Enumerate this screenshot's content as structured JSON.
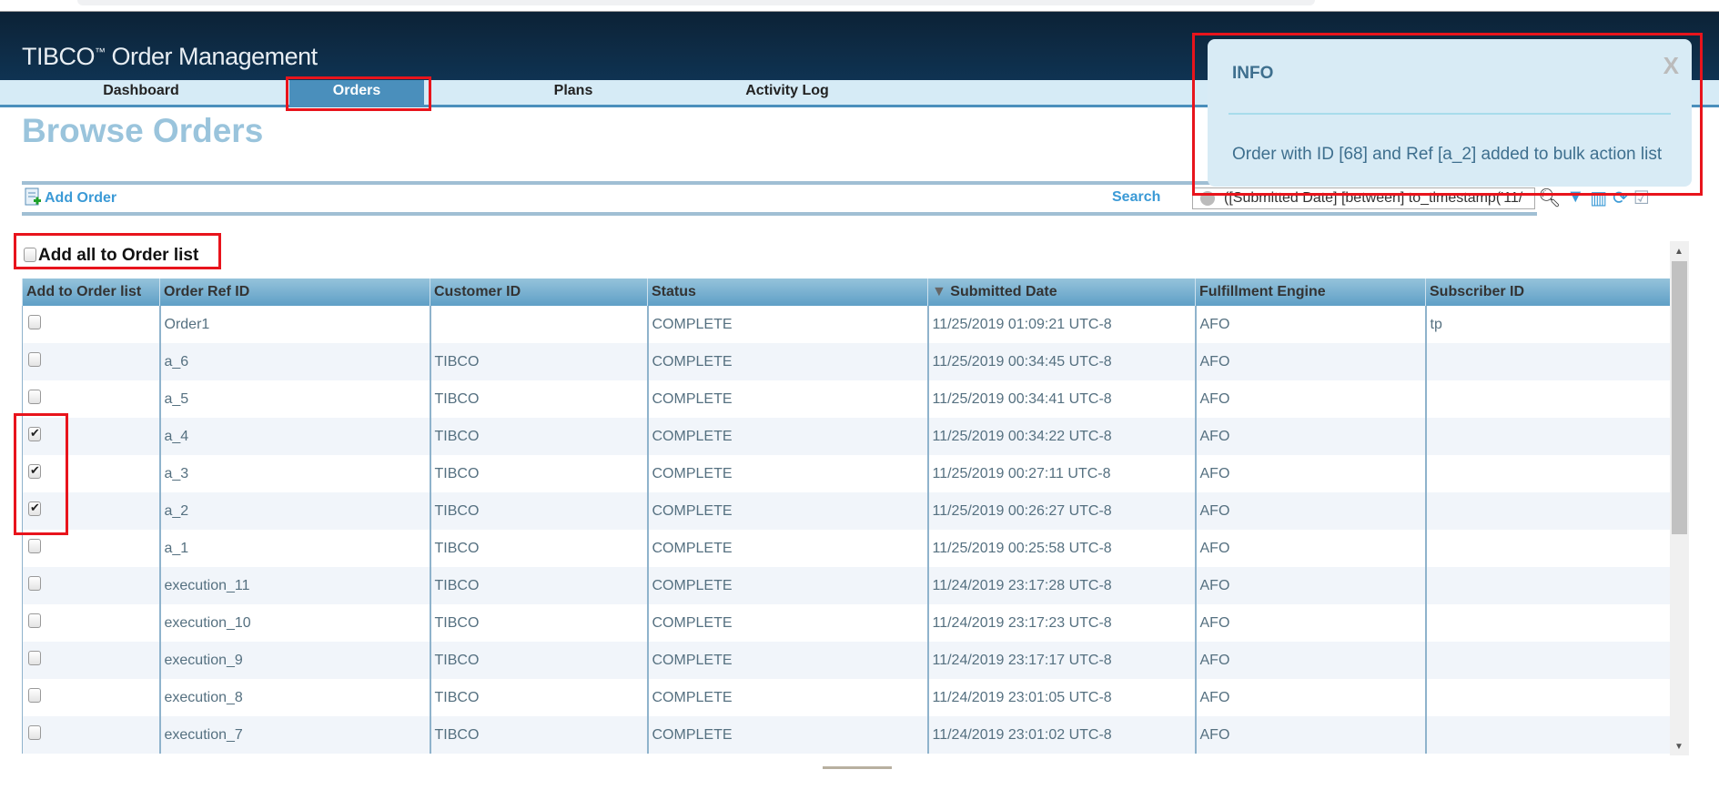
{
  "app": {
    "brand": "TIBCO",
    "tm": "™",
    "title": "Order Management"
  },
  "nav": {
    "tabs": [
      {
        "label": "Dashboard"
      },
      {
        "label": "Orders",
        "active": true
      },
      {
        "label": "Plans"
      },
      {
        "label": "Activity Log"
      }
    ]
  },
  "page": {
    "title": "Browse Orders"
  },
  "toolbar": {
    "add_order": "Add Order",
    "search_label": "Search",
    "search_value": "([Submitted Date] [between] to_timestamp('11/"
  },
  "bulk": {
    "add_all_label": "Add all to Order list",
    "checked": false
  },
  "table": {
    "columns": [
      "Add to Order list",
      "Order Ref ID",
      "Customer ID",
      "Status",
      "Submitted Date",
      "Fulfillment Engine",
      "Subscriber ID"
    ],
    "sort_column": "Submitted Date",
    "sort_direction": "descending",
    "rows": [
      {
        "checked": false,
        "ref": "Order1",
        "customer": "",
        "status": "COMPLETE",
        "date": "11/25/2019 01:09:21 UTC-8",
        "engine": "AFO",
        "subscriber": "tp"
      },
      {
        "checked": false,
        "ref": "a_6",
        "customer": "TIBCO",
        "status": "COMPLETE",
        "date": "11/25/2019 00:34:45 UTC-8",
        "engine": "AFO",
        "subscriber": ""
      },
      {
        "checked": false,
        "ref": "a_5",
        "customer": "TIBCO",
        "status": "COMPLETE",
        "date": "11/25/2019 00:34:41 UTC-8",
        "engine": "AFO",
        "subscriber": ""
      },
      {
        "checked": true,
        "ref": "a_4",
        "customer": "TIBCO",
        "status": "COMPLETE",
        "date": "11/25/2019 00:34:22 UTC-8",
        "engine": "AFO",
        "subscriber": ""
      },
      {
        "checked": true,
        "ref": "a_3",
        "customer": "TIBCO",
        "status": "COMPLETE",
        "date": "11/25/2019 00:27:11 UTC-8",
        "engine": "AFO",
        "subscriber": ""
      },
      {
        "checked": true,
        "ref": "a_2",
        "customer": "TIBCO",
        "status": "COMPLETE",
        "date": "11/25/2019 00:26:27 UTC-8",
        "engine": "AFO",
        "subscriber": ""
      },
      {
        "checked": false,
        "ref": "a_1",
        "customer": "TIBCO",
        "status": "COMPLETE",
        "date": "11/25/2019 00:25:58 UTC-8",
        "engine": "AFO",
        "subscriber": ""
      },
      {
        "checked": false,
        "ref": "execution_11",
        "customer": "TIBCO",
        "status": "COMPLETE",
        "date": "11/24/2019 23:17:28 UTC-8",
        "engine": "AFO",
        "subscriber": ""
      },
      {
        "checked": false,
        "ref": "execution_10",
        "customer": "TIBCO",
        "status": "COMPLETE",
        "date": "11/24/2019 23:17:23 UTC-8",
        "engine": "AFO",
        "subscriber": ""
      },
      {
        "checked": false,
        "ref": "execution_9",
        "customer": "TIBCO",
        "status": "COMPLETE",
        "date": "11/24/2019 23:17:17 UTC-8",
        "engine": "AFO",
        "subscriber": ""
      },
      {
        "checked": false,
        "ref": "execution_8",
        "customer": "TIBCO",
        "status": "COMPLETE",
        "date": "11/24/2019 23:01:05 UTC-8",
        "engine": "AFO",
        "subscriber": ""
      },
      {
        "checked": false,
        "ref": "execution_7",
        "customer": "TIBCO",
        "status": "COMPLETE",
        "date": "11/24/2019 23:01:02 UTC-8",
        "engine": "AFO",
        "subscriber": ""
      }
    ]
  },
  "notification": {
    "icon": "",
    "title": "INFO",
    "close": "X",
    "message": "Order with ID [68] and Ref [a_2] added to bulk action list"
  },
  "colors": {
    "header": "#0f3352",
    "accent": "#4a8fbc",
    "link": "#3b9ad6",
    "highlight": "#e8141c"
  }
}
